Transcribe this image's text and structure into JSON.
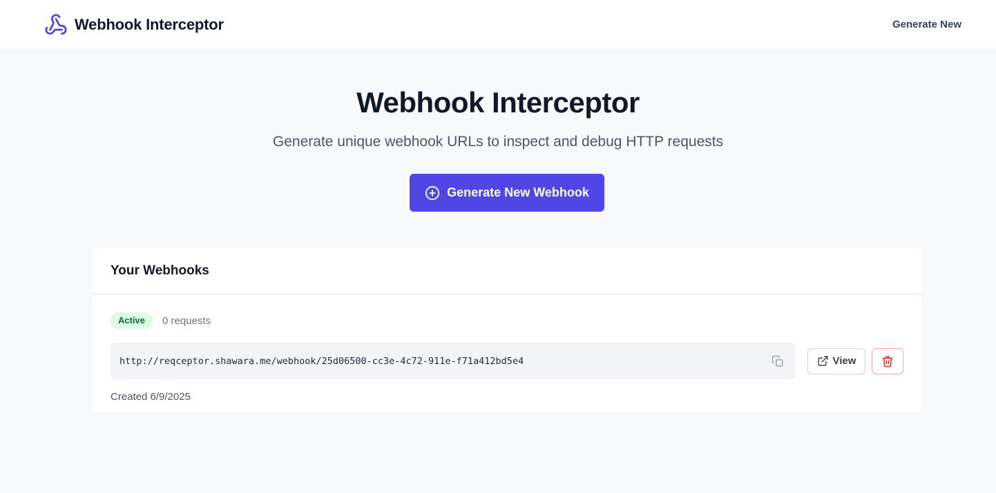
{
  "app": {
    "title": "Webhook Interceptor",
    "accent_color": "#4f46e5",
    "logo_icon": "webhook-icon"
  },
  "nav": {
    "generate_new": "Generate New"
  },
  "hero": {
    "title": "Webhook Interceptor",
    "subtitle": "Generate unique webhook URLs to inspect and debug HTTP requests",
    "button_label": "Generate New Webhook",
    "button_icon": "plus-circle-icon"
  },
  "webhooks": {
    "heading": "Your Webhooks",
    "items": [
      {
        "status": "Active",
        "status_color": "#166534",
        "requests": "0 requests",
        "url": "http://reqceptor.shawara.me/webhook/25d06500-cc3e-4c72-911e-f71a412bd5e4",
        "view_label": "View",
        "created": "Created 6/9/2025"
      }
    ]
  }
}
